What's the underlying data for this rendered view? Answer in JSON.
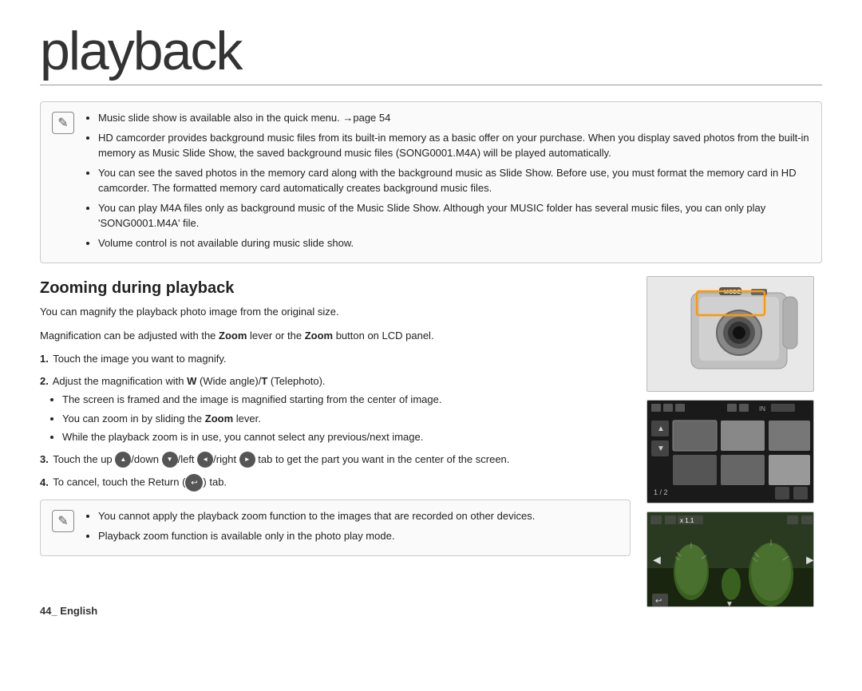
{
  "page": {
    "title": "playback",
    "footer": "44_ English"
  },
  "notes": {
    "icon": "✎",
    "items": [
      "Music slide show is available also in the quick menu. →page 54",
      "HD camcorder provides background music files from its built-in memory as a basic offer on your purchase. When you display saved photos from the built-in memory as Music Slide Show, the saved background music files (SONG0001.M4A) will be played automatically.",
      "You can see the saved photos in the memory card along with the background music as Slide Show. Before use, you must format the memory card in HD camcorder. The formatted memory card automatically creates background music files.",
      "You can play M4A files only as background music of the Music Slide Show. Although your MUSIC folder has several music files, you can only play 'SONG0001.M4A' file.",
      "Volume control is not available during music slide show."
    ]
  },
  "zooming_section": {
    "title": "Zooming during playback",
    "intro_line1": "You can magnify the playback photo image from the original size.",
    "intro_line2": "Magnification can be adjusted with the Zoom lever or the Zoom button on LCD panel.",
    "steps": [
      {
        "num": "1.",
        "text": "Touch the image you want to magnify."
      },
      {
        "num": "2.",
        "text": "Adjust the magnification with W (Wide angle)/T (Telephoto).",
        "bullets": [
          "The screen is framed and the image is magnified starting from the center of image.",
          "You can zoom in by sliding the Zoom lever.",
          "While the playback zoom is in use, you cannot select any previous/next image."
        ]
      },
      {
        "num": "3.",
        "text": "Touch the up (▲)/down (▼)/left (◄)/right (►) tab to get the part you want in the center of the screen."
      },
      {
        "num": "4.",
        "text": "To cancel, touch the Return (↩) tab."
      }
    ]
  },
  "note2": {
    "items": [
      "You cannot apply the playback zoom function to the images that are recorded on other devices.",
      "Playback zoom function is available only in the photo play mode."
    ]
  },
  "images": {
    "cam1_mode_label": "MODE",
    "zoom_label": "x 1.1",
    "page_count": "1 / 2"
  }
}
